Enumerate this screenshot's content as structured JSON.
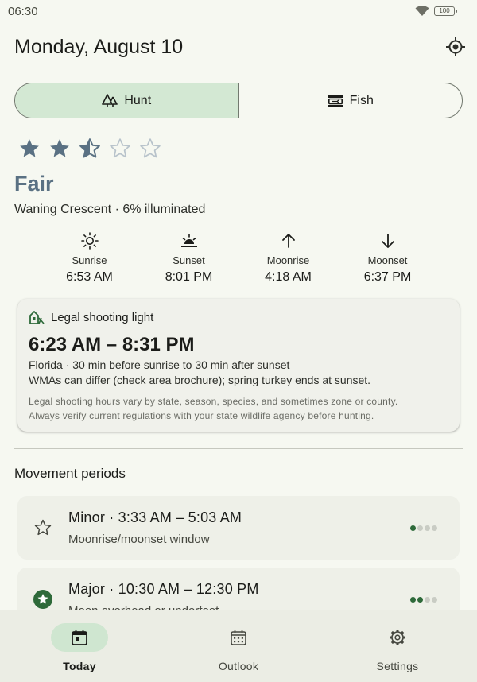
{
  "status_bar": {
    "time": "06:30",
    "battery": "100"
  },
  "header": {
    "title": "Monday, August 10",
    "locate_icon": "my-location-icon"
  },
  "segments": [
    {
      "label": "Hunt",
      "icon": "trees-icon",
      "selected": true
    },
    {
      "label": "Fish",
      "icon": "fish-icon",
      "selected": false
    }
  ],
  "rating": {
    "stars": 2.5,
    "max": 5,
    "label": "Fair",
    "star_color": "#5a7183"
  },
  "moon": {
    "phase_text": "Waning Crescent · 6% illuminated"
  },
  "sun_moon_times": [
    {
      "label": "Sunrise",
      "value": "6:53 AM",
      "icon": "sunrise-icon"
    },
    {
      "label": "Sunset",
      "value": "8:01 PM",
      "icon": "sunset-icon"
    },
    {
      "label": "Moonrise",
      "value": "4:18 AM",
      "icon": "arrow-up-icon"
    },
    {
      "label": "Moonset",
      "value": "6:37 PM",
      "icon": "arrow-down-icon"
    }
  ],
  "legal_light": {
    "title": "Legal shooting light",
    "time_range": "6:23 AM – 8:31 PM",
    "rule": "Florida · 30 min before sunrise to 30 min after sunset",
    "note": "WMAs can differ (check area brochure); spring turkey ends at sunset.",
    "disclaimer_1": "Legal shooting hours vary by state, season, species, and sometimes zone or county.",
    "disclaimer_2": "Always verify current regulations with your state wildlife agency before hunting."
  },
  "movement": {
    "section_title": "Movement periods",
    "periods": [
      {
        "title": "Minor · 3:33 AM – 5:03 AM",
        "subtitle": "Moonrise/moonset window",
        "strength": 1,
        "icon": "star-outline-icon"
      },
      {
        "title": "Major · 10:30 AM – 12:30 PM",
        "subtitle": "Moon overhead or underfoot",
        "strength": 2,
        "icon": "star-badge-icon"
      }
    ]
  },
  "bottom_nav": [
    {
      "label": "Today",
      "icon": "calendar-today-icon",
      "active": true
    },
    {
      "label": "Outlook",
      "icon": "calendar-month-icon",
      "active": false
    },
    {
      "label": "Settings",
      "icon": "gear-icon",
      "active": false
    }
  ],
  "colors": {
    "accent": "#2e6a3a",
    "selected_bg": "#d3e8d3",
    "background": "#f6f8f1"
  }
}
